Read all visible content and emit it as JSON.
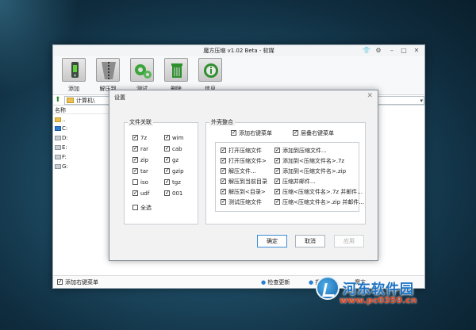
{
  "window": {
    "title": "魔方压缩 v1.02 Beta - 软媒"
  },
  "toolbar": {
    "buttons": [
      {
        "label": "添加",
        "icon": "add-icon"
      },
      {
        "label": "解压到",
        "icon": "extract-icon"
      },
      {
        "label": "测试",
        "icon": "test-icon"
      },
      {
        "label": "删除",
        "icon": "delete-icon"
      },
      {
        "label": "信息",
        "icon": "info-icon"
      }
    ]
  },
  "address": {
    "path": "计算机\\"
  },
  "filelist": {
    "header": "名称",
    "rows": [
      "..",
      "C:",
      "D:",
      "E:",
      "F:",
      "G:"
    ]
  },
  "statusbar": {
    "context_menu": "添加右键菜单",
    "check_update": "检查更新",
    "item3": "提供",
    "item4": "魔方"
  },
  "dialog": {
    "title": "设置",
    "assoc": {
      "title": "文件关联",
      "col1": [
        {
          "label": "7z",
          "checked": true
        },
        {
          "label": "rar",
          "checked": true
        },
        {
          "label": "zip",
          "checked": true
        },
        {
          "label": "tar",
          "checked": true
        },
        {
          "label": "iso",
          "checked": false
        },
        {
          "label": "udf",
          "checked": true
        }
      ],
      "col2": [
        {
          "label": "wim",
          "checked": true
        },
        {
          "label": "cab",
          "checked": true
        },
        {
          "label": "gz",
          "checked": true
        },
        {
          "label": "gzip",
          "checked": true
        },
        {
          "label": "tgz",
          "checked": true
        },
        {
          "label": "001",
          "checked": true
        }
      ],
      "select_all": "全选"
    },
    "shell": {
      "title": "外壳整合",
      "add_menu": "添加右键菜单",
      "cascade_menu": "层叠右键菜单",
      "left_items": [
        "打开压缩文件",
        "打开压缩文件>",
        "解压文件...",
        "解压到当前目录",
        "解压到<目录>",
        "测试压缩文件"
      ],
      "right_items": [
        "添加到压缩文件...",
        "添加到<压缩文件名>.7z",
        "添加到<压缩文件名>.zip",
        "压缩并邮件...",
        "压缩<压缩文件名>.7z 并邮件...",
        "压缩<压缩文件名>.zip 并邮件..."
      ]
    },
    "buttons": {
      "ok": "确定",
      "cancel": "取消",
      "apply": "应用"
    }
  },
  "watermark": {
    "brand": "河东软件园",
    "url": "www.pc0359.cn"
  }
}
